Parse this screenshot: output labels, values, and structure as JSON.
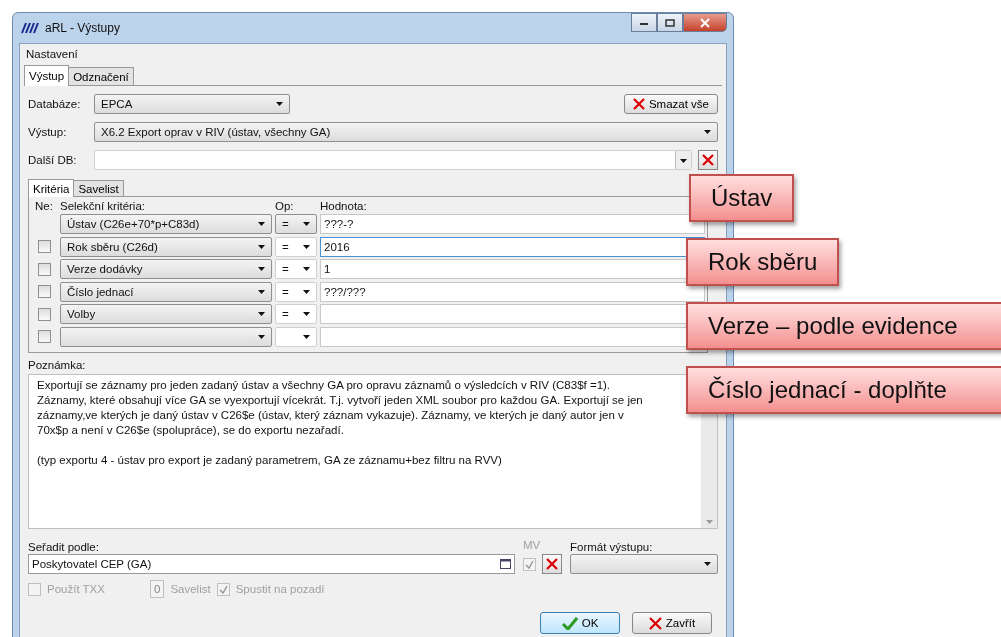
{
  "window": {
    "title": "aRL - Výstupy"
  },
  "menu": [
    "Nastavení"
  ],
  "tabs": [
    {
      "label": "Výstup",
      "selected": true
    },
    {
      "label": "Odznačení",
      "selected": false
    }
  ],
  "database": {
    "label": "Databáze:",
    "value": "EPCA"
  },
  "clear_all_button": "Smazat vše",
  "output": {
    "label": "Výstup:",
    "value": "X6.2 Export  oprav  v  RIV (ústav, všechny GA)"
  },
  "other_db": {
    "label": "Další DB:"
  },
  "inner_tabs": [
    {
      "label": "Kritéria",
      "selected": true
    },
    {
      "label": "Savelist",
      "selected": false
    }
  ],
  "criteria": {
    "columns": [
      "Ne:",
      "Selekční kritéria:",
      "Op:",
      "Hodnota:"
    ],
    "rows": [
      {
        "criterion": "Ústav (C26e+70*p+C83d)",
        "op": "=",
        "value": "???-?",
        "focused": false
      },
      {
        "checked": false,
        "criterion": "Rok sběru (C26d)",
        "op": "=",
        "value": "2016",
        "focused": true
      },
      {
        "checked": false,
        "criterion": "Verze dodávky",
        "op": "=",
        "value": "1",
        "focused": false
      },
      {
        "checked": false,
        "criterion": "Číslo jednací",
        "op": "=",
        "value": "???/???",
        "focused": false
      },
      {
        "checked": false,
        "criterion": "Volby",
        "op": "=",
        "focused": false
      },
      {
        "checked": false,
        "focused": false
      }
    ]
  },
  "note": {
    "label": "Poznámka:",
    "paragraphs": [
      "Exportují se záznamy pro jeden zadaný ústav a všechny GA pro opravu záznamů o výsledcích v RIV (C83$f =1). Záznamy, které obsahují více GA se vyexportují vícekrát. T.j. vytvoří jeden XML soubor pro každou GA. Exportují se jen záznamy,ve kterých je daný ústav v C26$e (ústav, který záznam vykazuje). Záznamy, ve kterých je daný autor jen v 70x$p a není v C26$e (spolupráce), se do exportu nezařadí.",
      "(typ exportu 4 - ústav pro export je zadaný parametrem, GA ze záznamu+bez filtru na RVV)"
    ]
  },
  "sort": {
    "label": "Seřadit podle:",
    "value": "Poskytovatel CEP (GA)"
  },
  "mv": {
    "label": "MV",
    "checked": true,
    "disabled": true
  },
  "format": {
    "label": "Formát výstupu:"
  },
  "options": [
    {
      "label": "Použít TXX",
      "checked": false,
      "disabled": true
    },
    {
      "label": "Spustit na pozadí",
      "checked": true,
      "disabled": true
    }
  ],
  "savelist": {
    "value": "0",
    "label": "Savelist"
  },
  "buttons": [
    {
      "kind": "ok",
      "label": "OK"
    },
    {
      "kind": "close",
      "label": "Zavřít"
    }
  ],
  "callouts": [
    "Ústav",
    "Rok sběru",
    "Verze – podle evidence",
    "Číslo jednací - doplňte"
  ]
}
